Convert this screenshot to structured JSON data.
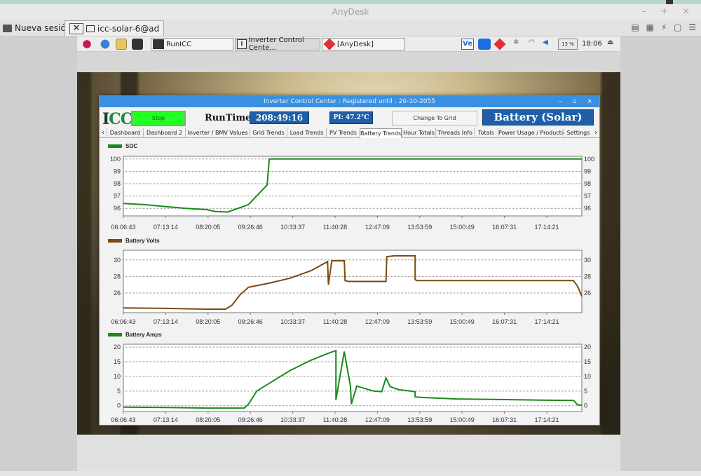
{
  "anydesk": {
    "window_title": "AnyDesk",
    "win_controls": "– + ×",
    "tab_home": "Nueva sesión",
    "tab_remote": "icc-solar-6@ad"
  },
  "remote_taskbar": {
    "items": [
      "RunICC",
      "Inverter Control Cente...",
      "[AnyDesk]"
    ],
    "volume": "13 %",
    "clock": "18:06"
  },
  "window": {
    "title": "Inverter Control Center : Registered until : 20-10-2055",
    "controls": "– ▫ ×"
  },
  "header": {
    "logo_left": "I",
    "logo_right": "CC",
    "stop_label": "Stop",
    "runtime_label": "RunTime",
    "runtime_value": "208:49:16",
    "pi_value": "PI: 47.2°C",
    "change_grid_label": "Change To Grid",
    "battery_mode": "Battery (Solar)"
  },
  "tabs": [
    "Dashboard",
    "Dashboard 2",
    "Inverter / BMV Values",
    "Grid Trends",
    "Load Trends",
    "PV Trends",
    "Battery Trends",
    "Hour Totals",
    "Threads Info",
    "Totals",
    "Power Usage / Production",
    "Settings"
  ],
  "active_tab": "Battery Trends",
  "chart_data": [
    {
      "type": "line",
      "title": "SOC",
      "series": [
        {
          "name": "SOC",
          "color": "#1a8a1a",
          "x": [
            0,
            0.5,
            1,
            1.5,
            2.0,
            2.2,
            2.5,
            3.0,
            3.45,
            3.5,
            5,
            11
          ],
          "y": [
            96.4,
            96.3,
            96.15,
            96.0,
            95.9,
            95.75,
            95.7,
            96.3,
            97.9,
            100,
            100,
            100
          ]
        }
      ],
      "x_ticks": [
        "06:06:43",
        "07:13:14",
        "08:20:05",
        "09:26:46",
        "10:33:37",
        "11:40:28",
        "12:47:09",
        "13:53:59",
        "15:00:49",
        "16:07:31",
        "17:14:21"
      ],
      "y_ticks": [
        100,
        99,
        98,
        97,
        96
      ],
      "ylim": [
        95.5,
        100.1
      ]
    },
    {
      "type": "line",
      "title": "Battery Volts",
      "series": [
        {
          "name": "Battery Volts",
          "color": "#7a4a10",
          "x": [
            0,
            1,
            2,
            2.45,
            2.6,
            2.8,
            3.0,
            3.5,
            4.0,
            4.5,
            4.9,
            4.92,
            5.0,
            5.3,
            5.32,
            5.4,
            6.0,
            6.3,
            6.32,
            6.5,
            7.0,
            7.0,
            7.05,
            8.0,
            9.0,
            10.0,
            10.8,
            10.9,
            11.0
          ],
          "y": [
            24.2,
            24.15,
            24.05,
            24.05,
            24.5,
            25.8,
            26.7,
            27.2,
            27.8,
            28.7,
            29.8,
            27.0,
            29.9,
            29.9,
            27.5,
            27.4,
            27.4,
            27.4,
            30.4,
            30.5,
            30.5,
            27.6,
            27.5,
            27.5,
            27.5,
            27.5,
            27.5,
            26.8,
            25.6
          ]
        }
      ],
      "x_ticks": [
        "06:06:43",
        "07:13:14",
        "08:20:05",
        "09:26:46",
        "10:33:37",
        "11:40:28",
        "12:47:09",
        "13:53:59",
        "15:00:49",
        "16:07:31",
        "17:14:21"
      ],
      "y_ticks": [
        30,
        28,
        26
      ],
      "ylim": [
        23.8,
        31.0
      ]
    },
    {
      "type": "line",
      "title": "Battery Amps",
      "series": [
        {
          "name": "Battery Amps",
          "color": "#1a8a1a",
          "x": [
            0,
            1,
            2,
            2.9,
            3.0,
            3.2,
            3.6,
            4.0,
            4.5,
            4.9,
            5.1,
            5.1,
            5.3,
            5.45,
            5.47,
            5.6,
            6.0,
            6.2,
            6.3,
            6.4,
            6.6,
            7.0,
            7.0,
            7.2,
            8.0,
            9.0,
            10.0,
            10.8,
            10.9,
            11.0
          ],
          "y": [
            -0.5,
            -0.6,
            -0.8,
            -0.8,
            0.5,
            5.0,
            8.5,
            12.0,
            15.5,
            17.8,
            18.8,
            2.0,
            18.5,
            6.5,
            0.5,
            6.7,
            5.0,
            4.8,
            9.5,
            6.5,
            5.5,
            4.8,
            3.0,
            2.8,
            2.3,
            2.1,
            1.9,
            1.8,
            0.3,
            0.2
          ]
        }
      ],
      "x_ticks": [
        "06:06:43",
        "07:13:14",
        "08:20:05",
        "09:26:46",
        "10:33:37",
        "11:40:28",
        "12:47:09",
        "13:53:59",
        "15:00:49",
        "16:07:31",
        "17:14:21"
      ],
      "y_ticks": [
        20,
        15,
        10,
        5,
        0
      ],
      "ylim": [
        -1.5,
        20.5
      ]
    }
  ]
}
